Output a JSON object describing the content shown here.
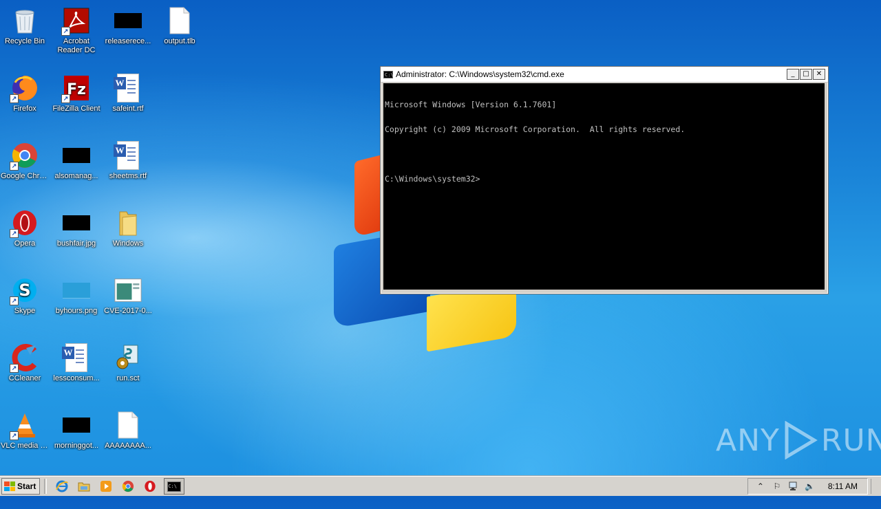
{
  "desktop": {
    "icons": [
      {
        "label": "Recycle Bin",
        "icon": "recycle-bin-icon",
        "shortcut": false
      },
      {
        "label": "Acrobat Reader DC",
        "icon": "acrobat-reader-icon",
        "shortcut": true
      },
      {
        "label": "releaserece...",
        "icon": "blank-thumbnail-icon",
        "shortcut": false
      },
      {
        "label": "output.tlb",
        "icon": "blank-file-icon",
        "shortcut": false
      },
      {
        "label": "Firefox",
        "icon": "firefox-icon",
        "shortcut": true
      },
      {
        "label": "FileZilla Client",
        "icon": "filezilla-icon",
        "shortcut": true
      },
      {
        "label": "safeint.rtf",
        "icon": "word-document-icon",
        "shortcut": false
      },
      {
        "label": "Google Chrome",
        "icon": "chrome-icon",
        "shortcut": true
      },
      {
        "label": "alsomanag...",
        "icon": "blank-thumbnail-icon",
        "shortcut": false
      },
      {
        "label": "sheetms.rtf",
        "icon": "word-document-icon",
        "shortcut": false
      },
      {
        "label": "Opera",
        "icon": "opera-icon",
        "shortcut": true
      },
      {
        "label": "bushfair.jpg",
        "icon": "image-thumbnail-icon",
        "shortcut": false
      },
      {
        "label": "Windows",
        "icon": "folder-icon",
        "shortcut": false
      },
      {
        "label": "Skype",
        "icon": "skype-icon",
        "shortcut": true
      },
      {
        "label": "byhours.png",
        "icon": "image-thumbnail-icon",
        "shortcut": false
      },
      {
        "label": "CVE-2017-0...",
        "icon": "document-thumbnail-icon",
        "shortcut": false
      },
      {
        "label": "CCleaner",
        "icon": "ccleaner-icon",
        "shortcut": true
      },
      {
        "label": "lessconsum...",
        "icon": "word-document-icon",
        "shortcut": false
      },
      {
        "label": "run.sct",
        "icon": "script-gear-icon",
        "shortcut": false
      },
      {
        "label": "VLC media player",
        "icon": "vlc-icon",
        "shortcut": true
      },
      {
        "label": "morninggot...",
        "icon": "blank-thumbnail-icon",
        "shortcut": false
      },
      {
        "label": "AAAAAAAA...",
        "icon": "blank-file-icon",
        "shortcut": false
      }
    ]
  },
  "cmd_window": {
    "title": "Administrator: C:\\Windows\\system32\\cmd.exe",
    "icon": "console-icon",
    "controls": {
      "minimize": "_",
      "maximize": "□",
      "close": "✕"
    },
    "lines": [
      "Microsoft Windows [Version 6.1.7601]",
      "Copyright (c) 2009 Microsoft Corporation.  All rights reserved.",
      "",
      "C:\\Windows\\system32>"
    ]
  },
  "watermark": {
    "left": "ANY",
    "right": "RUN"
  },
  "taskbar": {
    "start_label": "Start",
    "pinned": [
      "internet-explorer-icon",
      "explorer-folder-icon",
      "media-player-icon",
      "chrome-icon",
      "opera-icon"
    ],
    "active_task_icon": "console-icon",
    "tray_icons": [
      "show-hidden-icons-icon",
      "action-center-flag-icon",
      "network-icon",
      "volume-icon"
    ],
    "clock": "8:11 AM"
  },
  "colors": {
    "cmd_background": "#000000",
    "cmd_text": "#c0c0c0",
    "taskbar": "#d6d3ce"
  }
}
